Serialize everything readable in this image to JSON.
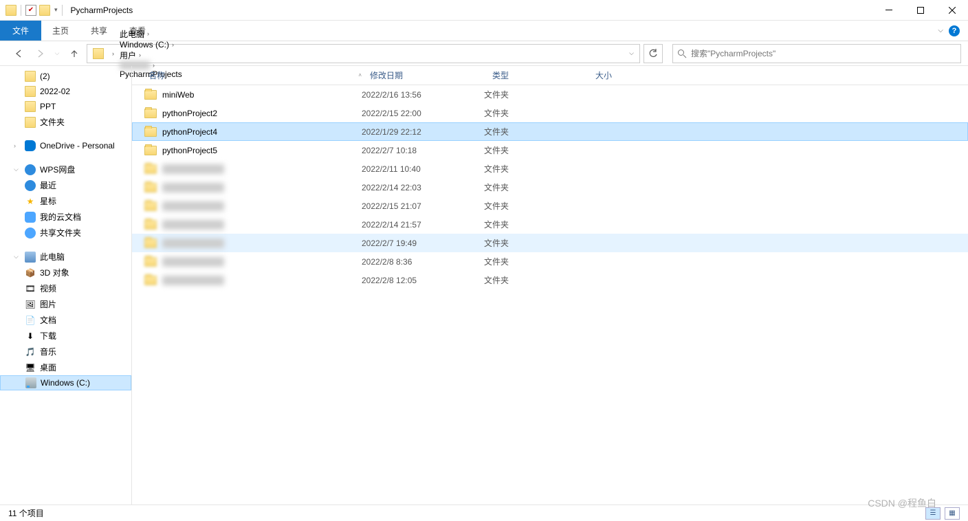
{
  "title": "PycharmProjects",
  "ribbon": {
    "file": "文件",
    "home": "主页",
    "share": "共享",
    "view": "查看"
  },
  "breadcrumbs": [
    "此电脑",
    "Windows (C:)",
    "用户",
    "",
    "PycharmProjects"
  ],
  "search_placeholder": "搜索\"PycharmProjects\"",
  "nav_pane": {
    "quick": [
      {
        "label": "(2)"
      },
      {
        "label": "2022-02"
      },
      {
        "label": "PPT"
      },
      {
        "label": "文件夹"
      }
    ],
    "onedrive": "OneDrive - Personal",
    "wps": {
      "root": "WPS网盘",
      "items": [
        "最近",
        "星标",
        "我的云文档",
        "共享文件夹"
      ]
    },
    "pc": {
      "root": "此电脑",
      "items": [
        "3D 对象",
        "视频",
        "图片",
        "文档",
        "下载",
        "音乐",
        "桌面",
        "Windows (C:)"
      ]
    }
  },
  "columns": {
    "name": "名称",
    "date": "修改日期",
    "type": "类型",
    "size": "大小"
  },
  "rows": [
    {
      "name": "miniWeb",
      "date": "2022/2/16 13:56",
      "type": "文件夹",
      "blurred": false,
      "state": ""
    },
    {
      "name": "pythonProject2",
      "date": "2022/2/15 22:00",
      "type": "文件夹",
      "blurred": false,
      "state": ""
    },
    {
      "name": "pythonProject4",
      "date": "2022/1/29 22:12",
      "type": "文件夹",
      "blurred": false,
      "state": "selected"
    },
    {
      "name": "pythonProject5",
      "date": "2022/2/7 10:18",
      "type": "文件夹",
      "blurred": false,
      "state": ""
    },
    {
      "name": "",
      "date": "2022/2/11 10:40",
      "type": "文件夹",
      "blurred": true,
      "state": ""
    },
    {
      "name": "",
      "date": "2022/2/14 22:03",
      "type": "文件夹",
      "blurred": true,
      "state": ""
    },
    {
      "name": "",
      "date": "2022/2/15 21:07",
      "type": "文件夹",
      "blurred": true,
      "state": ""
    },
    {
      "name": "",
      "date": "2022/2/14 21:57",
      "type": "文件夹",
      "blurred": true,
      "state": ""
    },
    {
      "name": "",
      "date": "2022/2/7 19:49",
      "type": "文件夹",
      "blurred": true,
      "state": "highlight"
    },
    {
      "name": "",
      "date": "2022/2/8 8:36",
      "type": "文件夹",
      "blurred": true,
      "state": ""
    },
    {
      "name": "",
      "date": "2022/2/8 12:05",
      "type": "文件夹",
      "blurred": true,
      "state": ""
    }
  ],
  "status": "11 个项目",
  "watermark": "CSDN @程鱼白"
}
